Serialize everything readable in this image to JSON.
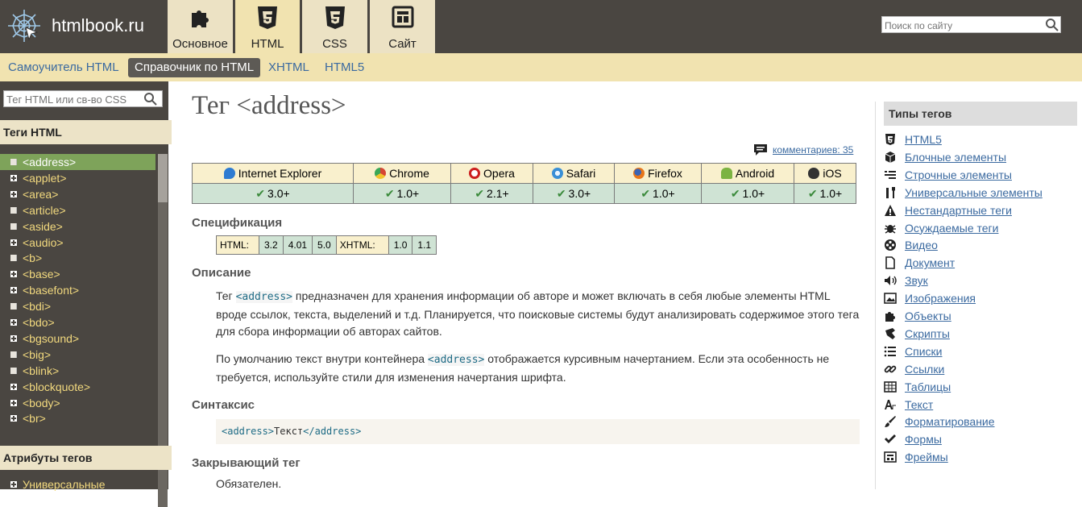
{
  "site": {
    "logo_text": "htmlbook.ru"
  },
  "top_tabs": [
    {
      "label": "Основное",
      "icon": "puzzle-icon",
      "active": false
    },
    {
      "label": "HTML",
      "icon": "html5-icon",
      "active": true
    },
    {
      "label": "CSS",
      "icon": "css3-icon",
      "active": false
    },
    {
      "label": "Сайт",
      "icon": "layout-icon",
      "active": false
    }
  ],
  "search": {
    "placeholder": "Поиск по сайту"
  },
  "subnav": [
    {
      "label": "Самоучитель HTML",
      "active": false
    },
    {
      "label": "Справочник по HTML",
      "active": true
    },
    {
      "label": "XHTML",
      "active": false
    },
    {
      "label": "HTML5",
      "active": false
    }
  ],
  "sidebar": {
    "search_placeholder": "Тег HTML или св-во CSS",
    "tags_heading": "Теги HTML",
    "tags": [
      {
        "label": "<address>",
        "icon": "doc",
        "active": true
      },
      {
        "label": "<applet>",
        "icon": "plus"
      },
      {
        "label": "<area>",
        "icon": "plus"
      },
      {
        "label": "<article>",
        "icon": "doc"
      },
      {
        "label": "<aside>",
        "icon": "doc"
      },
      {
        "label": "<audio>",
        "icon": "plus"
      },
      {
        "label": "<b>",
        "icon": "doc"
      },
      {
        "label": "<base>",
        "icon": "plus"
      },
      {
        "label": "<basefont>",
        "icon": "plus"
      },
      {
        "label": "<bdi>",
        "icon": "doc"
      },
      {
        "label": "<bdo>",
        "icon": "plus"
      },
      {
        "label": "<bgsound>",
        "icon": "plus"
      },
      {
        "label": "<big>",
        "icon": "doc"
      },
      {
        "label": "<blink>",
        "icon": "doc"
      },
      {
        "label": "<blockquote>",
        "icon": "plus"
      },
      {
        "label": "<body>",
        "icon": "plus"
      },
      {
        "label": "<br>",
        "icon": "plus"
      }
    ],
    "attrs_heading": "Атрибуты тегов",
    "attrs_first": "Универсальные"
  },
  "main": {
    "title": "Тег <address>",
    "comments_label": "комментариев: 35",
    "browsers": [
      {
        "name": "Internet Explorer",
        "version": "3.0+",
        "color": "#2e7bd1"
      },
      {
        "name": "Chrome",
        "version": "1.0+",
        "color": "#d64534"
      },
      {
        "name": "Opera",
        "version": "2.1+",
        "color": "#cc1f1f"
      },
      {
        "name": "Safari",
        "version": "3.0+",
        "color": "#3a8fd6"
      },
      {
        "name": "Firefox",
        "version": "1.0+",
        "color": "#e8761a"
      },
      {
        "name": "Android",
        "version": "1.0+",
        "color": "#7cb342"
      },
      {
        "name": "iOS",
        "version": "1.0+",
        "color": "#333333"
      }
    ],
    "spec_heading": "Спецификация",
    "spec": {
      "html_label": "HTML:",
      "html_versions": [
        "3.2",
        "4.01",
        "5.0"
      ],
      "xhtml_label": "XHTML:",
      "xhtml_versions": [
        "1.0",
        "1.1"
      ]
    },
    "desc_heading": "Описание",
    "desc_p1_pre": "Тег ",
    "desc_p1_code": "<address>",
    "desc_p1_post": " предназначен для хранения информации об авторе и может включать в себя любые элементы HTML вроде ссылок, текста, выделений и т.д. Планируется, что поисковые системы будут анализировать содержимое этого тега для сбора информации об авторах сайтов.",
    "desc_p2_pre": "По умолчанию текст внутри контейнера ",
    "desc_p2_code": "<address>",
    "desc_p2_post": " отображается курсивным начертанием. Если эта особенность не требуется, используйте стили для изменения начертания шрифта.",
    "syntax_heading": "Синтаксис",
    "syntax_open": "<address>",
    "syntax_text": "Текст",
    "syntax_close": "</address>",
    "closing_heading": "Закрывающий тег",
    "closing_text": "Обязателен."
  },
  "right": {
    "heading": "Типы тегов",
    "items": [
      {
        "label": "HTML5",
        "icon": "html5-icon"
      },
      {
        "label": "Блочные элементы",
        "icon": "box-icon"
      },
      {
        "label": "Строчные элементы",
        "icon": "inline-icon"
      },
      {
        "label": "Универсальные элементы",
        "icon": "tools-icon"
      },
      {
        "label": "Нестандартные теги",
        "icon": "warning-icon"
      },
      {
        "label": "Осуждаемые теги",
        "icon": "bug-icon"
      },
      {
        "label": "Видео",
        "icon": "film-icon"
      },
      {
        "label": "Документ",
        "icon": "document-icon"
      },
      {
        "label": "Звук",
        "icon": "sound-icon"
      },
      {
        "label": "Изображения",
        "icon": "image-icon"
      },
      {
        "label": "Объекты",
        "icon": "puzzle-icon"
      },
      {
        "label": "Скрипты",
        "icon": "script-icon"
      },
      {
        "label": "Списки",
        "icon": "list-icon"
      },
      {
        "label": "Ссылки",
        "icon": "link-icon"
      },
      {
        "label": "Таблицы",
        "icon": "table-icon"
      },
      {
        "label": "Текст",
        "icon": "text-icon"
      },
      {
        "label": "Форматирование",
        "icon": "brush-icon"
      },
      {
        "label": "Формы",
        "icon": "check-icon"
      },
      {
        "label": "Фреймы",
        "icon": "frame-icon"
      }
    ]
  }
}
